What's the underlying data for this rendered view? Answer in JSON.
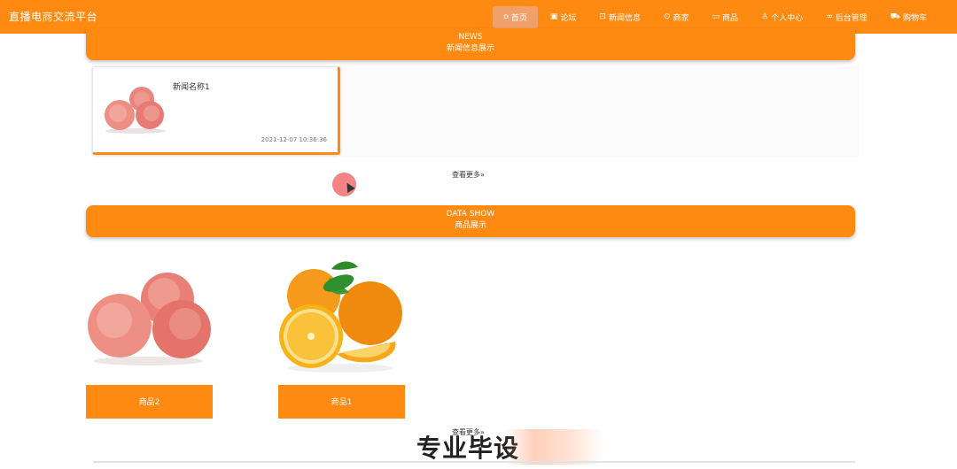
{
  "header": {
    "site_title": "直播电商交流平台",
    "nav": [
      {
        "icon": "home-icon",
        "glyph": "⌂",
        "label": "首页",
        "active": true
      },
      {
        "icon": "forum-icon",
        "glyph": "▣",
        "label": "论坛"
      },
      {
        "icon": "news-icon",
        "glyph": "⊡",
        "label": "新闻信息"
      },
      {
        "icon": "merchant-icon",
        "glyph": "⊙",
        "label": "商家"
      },
      {
        "icon": "product-icon",
        "glyph": "▭",
        "label": "商品"
      },
      {
        "icon": "user-icon",
        "glyph": "♙",
        "label": "个人中心"
      },
      {
        "icon": "link-icon",
        "glyph": "∞",
        "label": "后台管理"
      },
      {
        "icon": "cart-icon",
        "glyph": "⛟",
        "label": "购物车"
      }
    ]
  },
  "news_section": {
    "title_en": "NEWS",
    "title_cn": "新闻信息展示",
    "items": [
      {
        "name": "新闻名称1",
        "time": "2021-12-07 10:36:36"
      }
    ],
    "more_label": "查看更多"
  },
  "product_section": {
    "title_en": "DATA SHOW",
    "title_cn": "商品展示",
    "items": [
      {
        "name": "商品2"
      },
      {
        "name": "商品1"
      }
    ],
    "more_label": "查看更多"
  },
  "watermark": {
    "text": "专业毕设"
  }
}
